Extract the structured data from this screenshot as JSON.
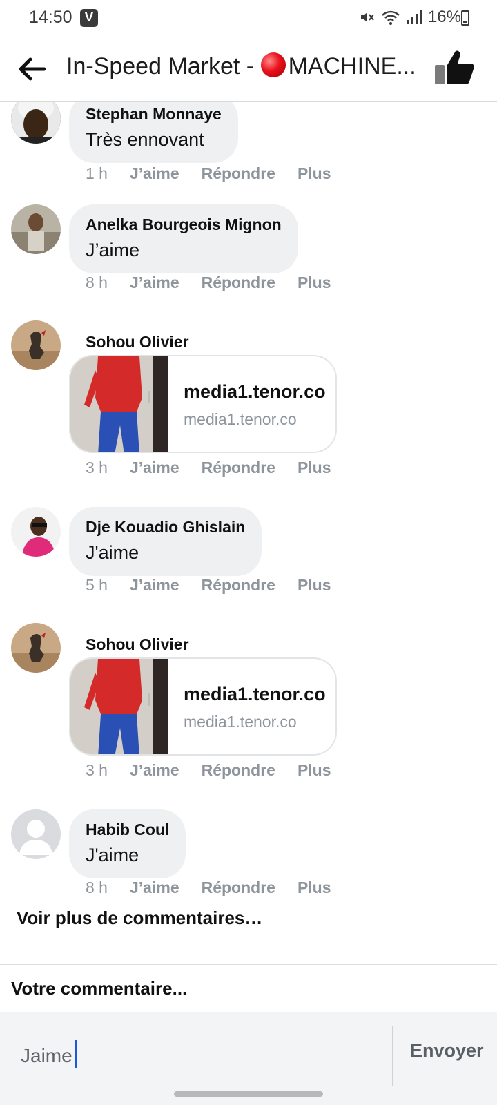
{
  "status_bar": {
    "time": "14:50",
    "app_icon_letter": "V",
    "battery": "16%"
  },
  "header": {
    "title": "In-Speed Market - ",
    "title_suffix": "MACHINE..."
  },
  "comments": [
    {
      "author": "Stephan Monnaye",
      "text": "Très ennovant",
      "time": "1 h",
      "like": "J’aime",
      "reply": "Répondre",
      "more": "Plus"
    },
    {
      "author": "Anelka Bourgeois Mignon",
      "text": "J’aime",
      "time": "8 h",
      "like": "J’aime",
      "reply": "Répondre",
      "more": "Plus"
    },
    {
      "author": "Sohou Olivier",
      "link_title": "media1.tenor.co",
      "link_domain": "media1.tenor.co",
      "time": "3 h",
      "like": "J’aime",
      "reply": "Répondre",
      "more": "Plus"
    },
    {
      "author": "Dje Kouadio Ghislain",
      "text": "J'aime",
      "time": "5 h",
      "like": "J’aime",
      "reply": "Répondre",
      "more": "Plus"
    },
    {
      "author": "Sohou Olivier",
      "link_title": "media1.tenor.co",
      "link_domain": "media1.tenor.co",
      "time": "3 h",
      "like": "J’aime",
      "reply": "Répondre",
      "more": "Plus"
    },
    {
      "author": "Habib Coul",
      "text": "J'aime",
      "time": "8 h",
      "like": "J’aime",
      "reply": "Répondre",
      "more": "Plus"
    }
  ],
  "more_comments": "Voir plus de commentaires…",
  "compose_label": "Votre commentaire...",
  "input": {
    "value": "Jaime"
  },
  "send_label": "Envoyer"
}
